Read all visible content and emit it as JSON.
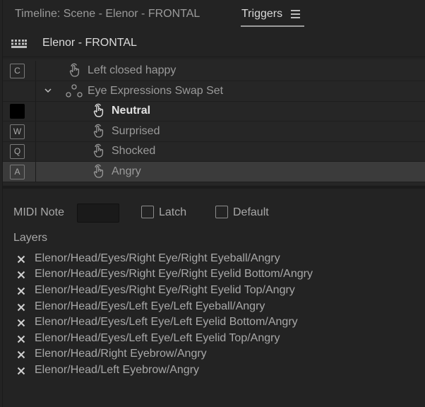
{
  "tabs": {
    "timeline": "Timeline: Scene - Elenor - FRONTAL",
    "triggers": "Triggers"
  },
  "header": {
    "title": "Elenor - FRONTAL"
  },
  "triggers": [
    {
      "key": "C",
      "label": "Left closed happy",
      "bold": false
    },
    {
      "key": "",
      "label": "Eye Expressions Swap Set",
      "group": true
    },
    {
      "key": "",
      "label": "Neutral",
      "bold": true,
      "key_filled": true
    },
    {
      "key": "W",
      "label": "Surprised",
      "bold": false
    },
    {
      "key": "Q",
      "label": "Shocked",
      "bold": false
    },
    {
      "key": "A",
      "label": "Angry",
      "bold": false,
      "selected": true
    }
  ],
  "properties": {
    "midi_note_label": "MIDI Note",
    "midi_note_value": "",
    "latch_label": "Latch",
    "latch_checked": false,
    "default_label": "Default",
    "default_checked": false,
    "layers_title": "Layers"
  },
  "layers": [
    "Elenor/Head/Eyes/Right Eye/Right Eyeball/Angry",
    "Elenor/Head/Eyes/Right Eye/Right Eyelid Bottom/Angry",
    "Elenor/Head/Eyes/Right Eye/Right Eyelid Top/Angry",
    "Elenor/Head/Eyes/Left Eye/Left Eyeball/Angry",
    "Elenor/Head/Eyes/Left Eye/Left Eyelid Bottom/Angry",
    "Elenor/Head/Eyes/Left Eye/Left Eyelid Top/Angry",
    "Elenor/Head/Right Eyebrow/Angry",
    "Elenor/Head/Left Eyebrow/Angry"
  ]
}
